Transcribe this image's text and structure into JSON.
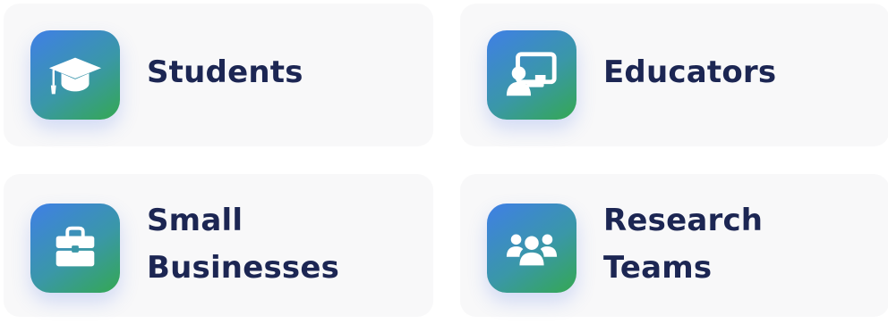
{
  "audience_cards": [
    {
      "label": "Students",
      "icon": "graduation-cap-icon"
    },
    {
      "label": "Educators",
      "icon": "teacher-whiteboard-icon"
    },
    {
      "label": "Small Businesses",
      "icon": "briefcase-icon"
    },
    {
      "label": "Research Teams",
      "icon": "users-group-icon"
    }
  ],
  "colors": {
    "card_background": "#f8f8f9",
    "label_text": "#1c2653",
    "icon_gradient_start": "#3f7fe6",
    "icon_gradient_end": "#34a852",
    "icon_foreground": "#ffffff"
  }
}
